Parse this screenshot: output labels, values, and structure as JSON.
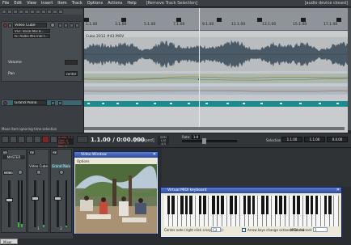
{
  "menubar": {
    "items": [
      "File",
      "Edit",
      "View",
      "Insert",
      "Item",
      "Track",
      "Options",
      "Actions",
      "Help"
    ],
    "title": "[Remove Track Selection]",
    "device_status": "[audio device closed]"
  },
  "tracks": {
    "items": [
      {
        "name": "Video Cube",
        "fx": "VST: Vocal Mix 8...",
        "fx2": "JS: Audio Mix ingl f..."
      },
      {
        "name": "Grand Piano"
      }
    ],
    "envelopes": [
      {
        "label": "Volume"
      },
      {
        "label": "Pan",
        "value": "center"
      }
    ]
  },
  "timeline": {
    "ruler_labels": [
      "1.1.00",
      "3.1.00",
      "5.1.00",
      "7.1.00",
      "9.1.00",
      "11.1.00",
      "13.1.00",
      "15.1.00",
      "17.1.00"
    ],
    "item_label": "Cuba 2012 #43.MOV"
  },
  "status": {
    "text": "Move item ignoring time selection"
  },
  "transport": {
    "audio_info": "Audio: 0.0\nDisk: 0\nMem: 0\nRec: 0",
    "position": "1.1.00 / 0:00.000",
    "state": "[Stopped]",
    "bpm": "BPM\n120\n4/4",
    "rate_label": "Rate:",
    "rate_value": "1.0",
    "selection_label": "Selection:",
    "selection_start": "1.1.00",
    "selection_end": "1.1.00",
    "selection_len": "0.0.00"
  },
  "mixer": {
    "strips": [
      {
        "name": "MASTER",
        "num": ""
      },
      {
        "name": "Video Cube",
        "num": "1"
      },
      {
        "name": "Grand Piano",
        "num": "2"
      }
    ],
    "mono_label": "MONO",
    "tab_label": "Mixer"
  },
  "video_window": {
    "title": "Video Window",
    "options": "Options"
  },
  "virtual_keyboard": {
    "title": "Virtual MIDI keyboard",
    "center_note_label": "Center note (right click a key to set):",
    "center_note_value": "C3",
    "arrow_keys_label": "Arrow keys change octave/channel",
    "midi_channel_label": "MIDI channel:",
    "midi_channel_value": "1"
  },
  "colors": {
    "accent": "#1b8b8f",
    "wave": "#4a5a66",
    "record": "#9a2a2a"
  }
}
